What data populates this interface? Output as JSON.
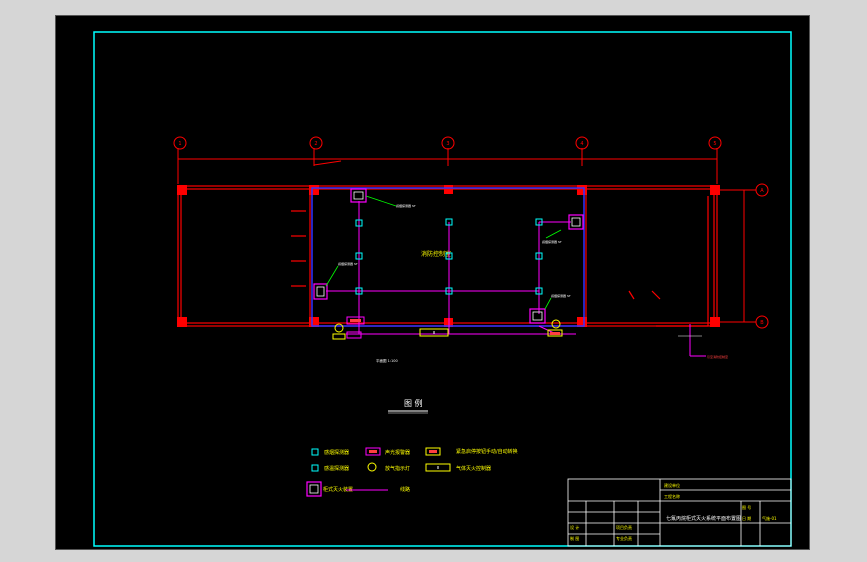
{
  "drawing": {
    "axis_labels_top": [
      "1",
      "2",
      "3",
      "4",
      "5"
    ],
    "axis_labels_right": [
      "A",
      "B"
    ],
    "room_label": "消防控制室",
    "scale_note": "平面图 1:100",
    "callout_labels": [
      "感烟探测器 ST",
      "感烟探测器 ST",
      "感烟探测器 ST",
      "感烟探测器 ST"
    ],
    "riser_label": "引至消防控制室"
  },
  "legend": {
    "title": "图    例",
    "items": [
      {
        "symbol": "smoke-detector",
        "label": "感烟探测器"
      },
      {
        "symbol": "sounder",
        "label": "声光报警器"
      },
      {
        "symbol": "manual-button",
        "label": "紧急启停按钮手动/自动转换"
      },
      {
        "symbol": "heat-detector",
        "label": "感温探测器"
      },
      {
        "symbol": "indicator-lamp",
        "label": "放气指示灯"
      },
      {
        "symbol": "gas-bottle",
        "label": "气体灭火控制器"
      },
      {
        "symbol": "extinguisher-unit",
        "label": "柜式灭火装置"
      },
      {
        "symbol": "wiring",
        "label": "线路"
      }
    ]
  },
  "title_block": {
    "row_labels_left": [
      "设 计",
      "制 图"
    ],
    "row_labels_mid": [
      "项目负责",
      "专业负责"
    ],
    "row_labels_right": [
      "图 号",
      "日 期"
    ],
    "top_labels": [
      "建设单位",
      "工程名称"
    ],
    "drawing_title": "七氟丙烷柜式灭火系统平面布置图",
    "drawing_no": "气施-01"
  },
  "colors": {
    "sheet": "#000000",
    "border": "#00ffff",
    "walls": "#ff0000",
    "room": "#0000ff",
    "wiring": "#ff00ff",
    "device": "#00ffff",
    "text": "#ffff00",
    "leader": "#00ff00"
  }
}
